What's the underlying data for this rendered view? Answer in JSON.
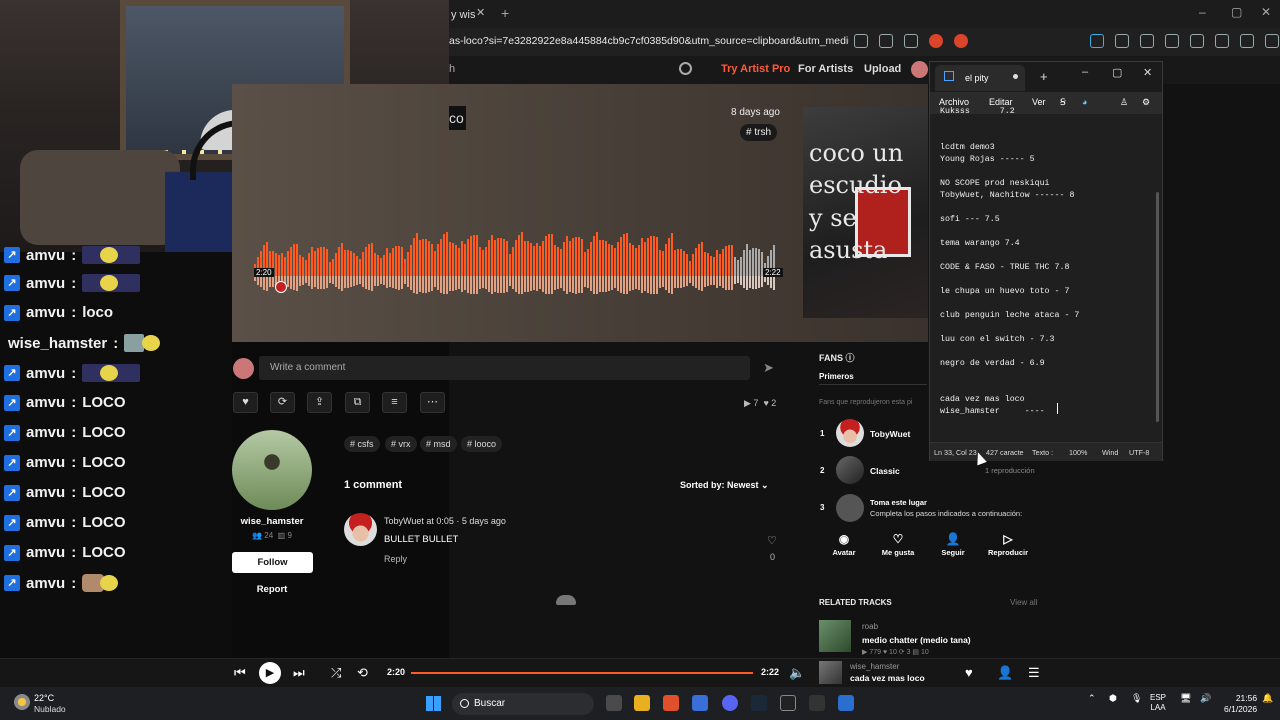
{
  "browser": {
    "tab_label": "y wis",
    "url": "as-loco?si=7e3282922e8a445884cb9c7cf0385d90&utm_source=clipboard&utm_medium=text..."
  },
  "soundcloud": {
    "search_fragment": "h",
    "nav": {
      "try_pro": "Try Artist Pro",
      "for_artists": "For Artists",
      "upload": "Upload"
    },
    "hero": {
      "title_fragment": "co",
      "date": "8 days ago",
      "tag": "# trsh"
    },
    "cover_text": "coco un\nescudio\ny se\nasusta",
    "waveform": {
      "current": "2:20",
      "total": "2:22",
      "progress": 0.054
    },
    "comment_placeholder": "Write a comment",
    "stats": {
      "plays": "7",
      "likes": "2"
    },
    "artist": {
      "name": "wise_hamster",
      "followers": "24",
      "tracks": "9",
      "follow": "Follow",
      "report": "Report"
    },
    "tags": [
      "# csfs",
      "# vrx",
      "# msd",
      "# looco"
    ],
    "comments_header": "1 comment",
    "sorted_by": "Sorted by: Newest",
    "comment": {
      "meta": "TobyWuet at 0:05 · 5 days ago",
      "text": "BULLET BULLET",
      "reply": "Reply",
      "likes": "0"
    },
    "fans": {
      "title": "FANS",
      "tab": "Primeros",
      "subtitle": "Fans que reprodujeron esta pi",
      "list": [
        {
          "rank": "1",
          "name": "TobyWuet",
          "sub": ""
        },
        {
          "rank": "2",
          "name": "Classic",
          "sub": "1 reproducción"
        },
        {
          "rank": "3",
          "name": "Toma este lugar",
          "sub": "Completa los pasos indicados a continuación:"
        }
      ],
      "actions": [
        "Avatar",
        "Me gusta",
        "Seguir",
        "Reproducir"
      ]
    },
    "related": {
      "title": "RELATED TRACKS",
      "view_all": "View all",
      "track": {
        "artist": "roab",
        "title": "medio chatter (medio tana)",
        "stats": "▶ 779  ♥ 10  ⟳ 3  ▤ 10"
      }
    }
  },
  "chat": [
    {
      "user": "amvu",
      "msg": "",
      "emote": "pepe"
    },
    {
      "user": "amvu",
      "msg": "",
      "emote": "pepe"
    },
    {
      "user": "amvu",
      "msg": "loco",
      "emote": ""
    },
    {
      "user": "wise_hamster",
      "msg": "",
      "emote": "hamster"
    },
    {
      "user": "amvu",
      "msg": "",
      "emote": "pepe"
    },
    {
      "user": "amvu",
      "msg": "LOCO",
      "emote": ""
    },
    {
      "user": "amvu",
      "msg": "LOCO",
      "emote": ""
    },
    {
      "user": "amvu",
      "msg": "LOCO",
      "emote": ""
    },
    {
      "user": "amvu",
      "msg": "LOCO",
      "emote": ""
    },
    {
      "user": "amvu",
      "msg": "LOCO",
      "emote": ""
    },
    {
      "user": "amvu",
      "msg": "LOCO",
      "emote": ""
    },
    {
      "user": "amvu",
      "msg": "",
      "emote": "dog"
    }
  ],
  "notepad": {
    "tab_title": "el pity",
    "menu": [
      "Archivo",
      "Editar",
      "Ver"
    ],
    "content": "Kuksss      7.2\n\n\nlcdtm demo3\nYoung Rojas ----- 5\n\nNO SCOPE prod neskiqui\nTobyWuet, Nachitow ------ 8\n\nsofi --- 7.5\n\ntema warango 7.4\n\nCODE & FASO - TRUE THC 7.8\n\nle chupa un huevo toto - 7\n\nclub penguin leche ataca - 7\n\nluu con el switch - 7.3\n\nnegro de verdad - 6.9\n\n\ncada vez mas loco\nwise_hamster     ----",
    "status": {
      "pos": "Ln 33, Col 23",
      "chars": "427 caracte",
      "type": "Texto :",
      "zoom": "100%",
      "eol": "Wind",
      "enc": "UTF-8"
    }
  },
  "player": {
    "elapsed": "2:20",
    "total": "2:22",
    "artist": "wise_hamster",
    "title": "cada vez mas loco"
  },
  "taskbar": {
    "temp": "22°C",
    "condition": "Nublado",
    "search": "Buscar",
    "lang_1": "ESP",
    "lang_2": "LAA",
    "time": "21:56",
    "date": "6/1/2026"
  },
  "colors": {
    "accent": "#ff5a1f",
    "pro": "#ff5a3c",
    "chat_badge": "#1f6fe0"
  }
}
